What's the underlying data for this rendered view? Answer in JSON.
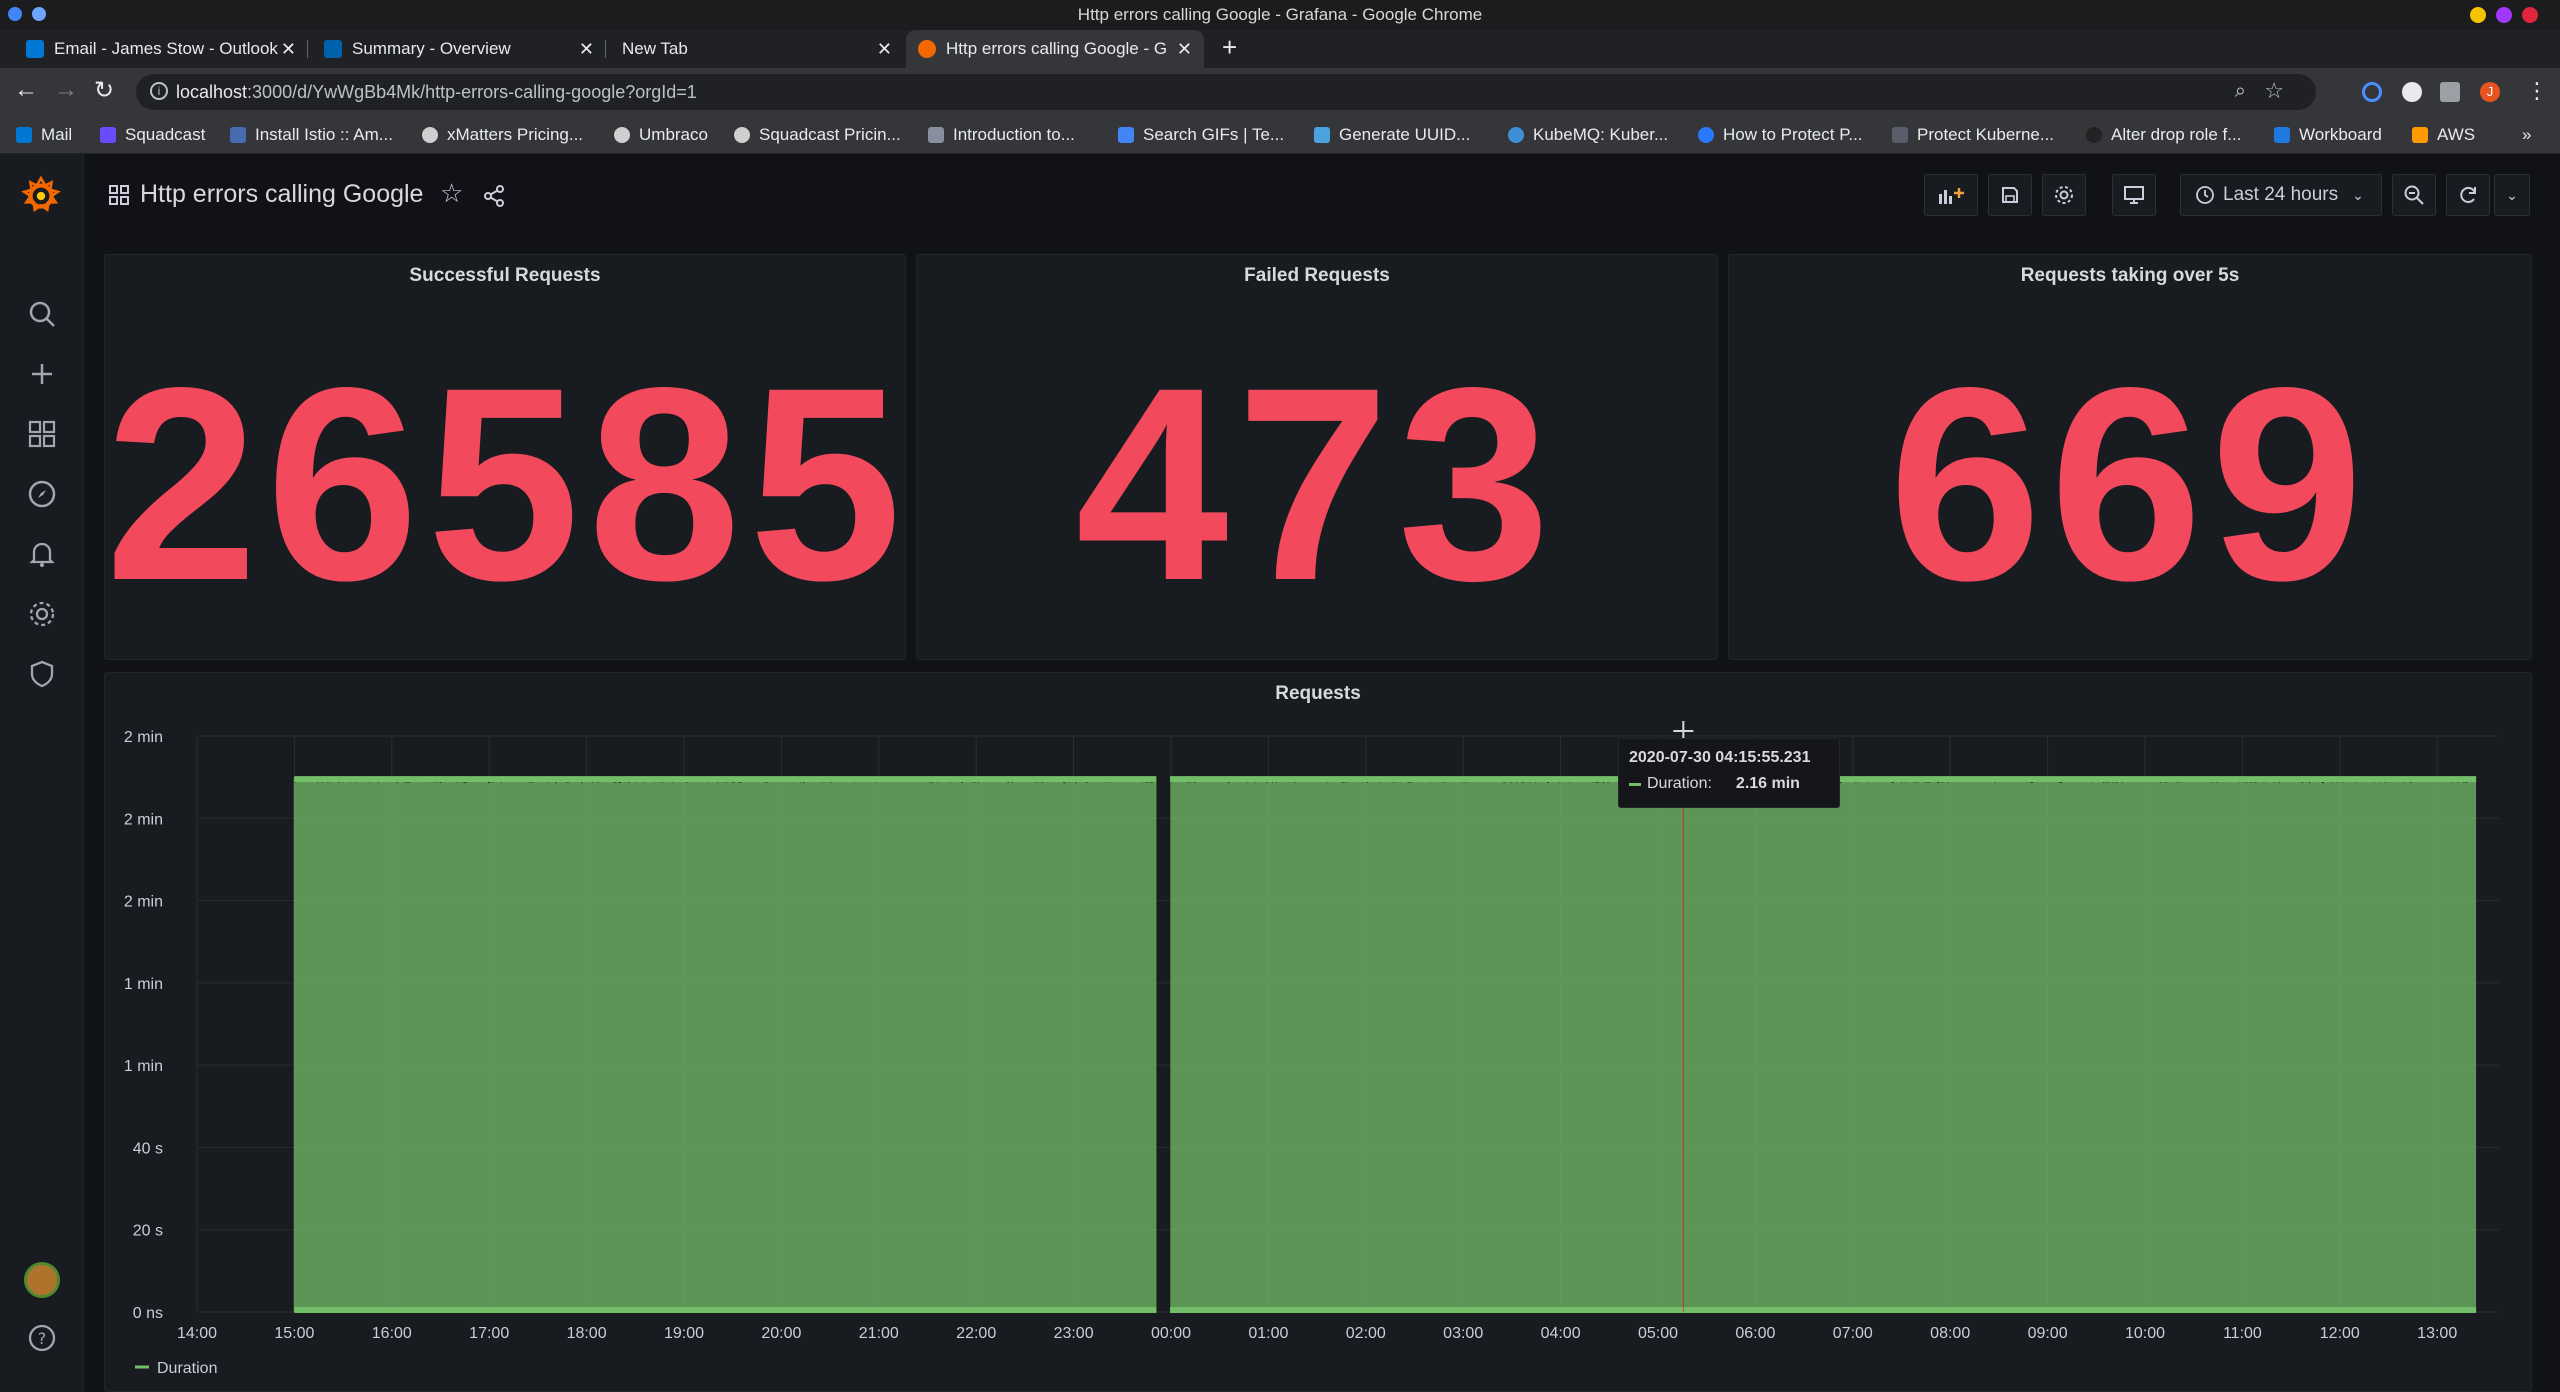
{
  "window": {
    "title": "Http errors calling Google - Grafana - Google Chrome"
  },
  "tabs": [
    {
      "label": "Email - James Stow - Outlook",
      "icon_color": "#0078d4",
      "active": false
    },
    {
      "label": "Summary - Overview",
      "icon_color": "#0062ad",
      "active": false
    },
    {
      "label": "New Tab",
      "icon_color": "",
      "active": false
    },
    {
      "label": "Http errors calling Google - G",
      "icon_color": "#f46800",
      "active": true
    }
  ],
  "address": {
    "host": "localhost",
    "path": ":3000/d/YwWgBb4Mk/http-errors-calling-google?orgId=1"
  },
  "bookmarks": [
    {
      "label": "Mail",
      "icon_color": "#0078d4"
    },
    {
      "label": "Squadcast",
      "icon_color": "#6a4cff"
    },
    {
      "label": "Install Istio :: Am...",
      "icon_color": "#466bb0"
    },
    {
      "label": "xMatters Pricing...",
      "icon_color": "#cfcfcf"
    },
    {
      "label": "Umbraco",
      "icon_color": "#cfcfcf"
    },
    {
      "label": "Squadcast Pricin...",
      "icon_color": "#cfcfcf"
    },
    {
      "label": "Introduction to...",
      "icon_color": "#8a8fa0"
    },
    {
      "label": "Search GIFs | Te...",
      "icon_color": "#4285f4"
    },
    {
      "label": "Generate UUID...",
      "icon_color": "#4aa3df"
    },
    {
      "label": "KubeMQ: Kuber...",
      "icon_color": "#3d8fd6"
    },
    {
      "label": "How to Protect P...",
      "icon_color": "#2979ff"
    },
    {
      "label": "Protect Kuberne...",
      "icon_color": "#5a5d6a"
    },
    {
      "label": "Alter drop role f...",
      "icon_color": "#222222"
    },
    {
      "label": "Workboard",
      "icon_color": "#1f7ae0"
    },
    {
      "label": "AWS",
      "icon_color": "#ff9900"
    }
  ],
  "dashboard": {
    "title": "Http errors calling Google",
    "time_range": "Last 24 hours"
  },
  "stats": [
    {
      "title": "Successful Requests",
      "value": "26585"
    },
    {
      "title": "Failed Requests",
      "value": "473"
    },
    {
      "title": "Requests taking over 5s",
      "value": "669"
    }
  ],
  "tooltip": {
    "time": "2020-07-30 04:15:55.231",
    "series": "Duration:",
    "value": "2.16 min"
  },
  "chart_data": {
    "type": "line",
    "title": "Requests",
    "x_ticks": [
      "14:00",
      "15:00",
      "16:00",
      "17:00",
      "18:00",
      "19:00",
      "20:00",
      "21:00",
      "22:00",
      "23:00",
      "00:00",
      "01:00",
      "02:00",
      "03:00",
      "04:00",
      "05:00",
      "06:00",
      "07:00",
      "08:00",
      "09:00",
      "10:00",
      "11:00",
      "12:00",
      "13:00"
    ],
    "y_ticks": [
      "0 ns",
      "20 s",
      "40 s",
      "1 min",
      "1 min",
      "2 min",
      "2 min",
      "2 min"
    ],
    "ylim_seconds": [
      0,
      140
    ],
    "series": [
      {
        "name": "Duration",
        "color": "#73bf69",
        "approx_max_seconds": 130,
        "approx_min_seconds": 0,
        "gap_hours": [
          9.5,
          9.67
        ]
      }
    ],
    "legend": "bottom-left",
    "grid": true
  }
}
